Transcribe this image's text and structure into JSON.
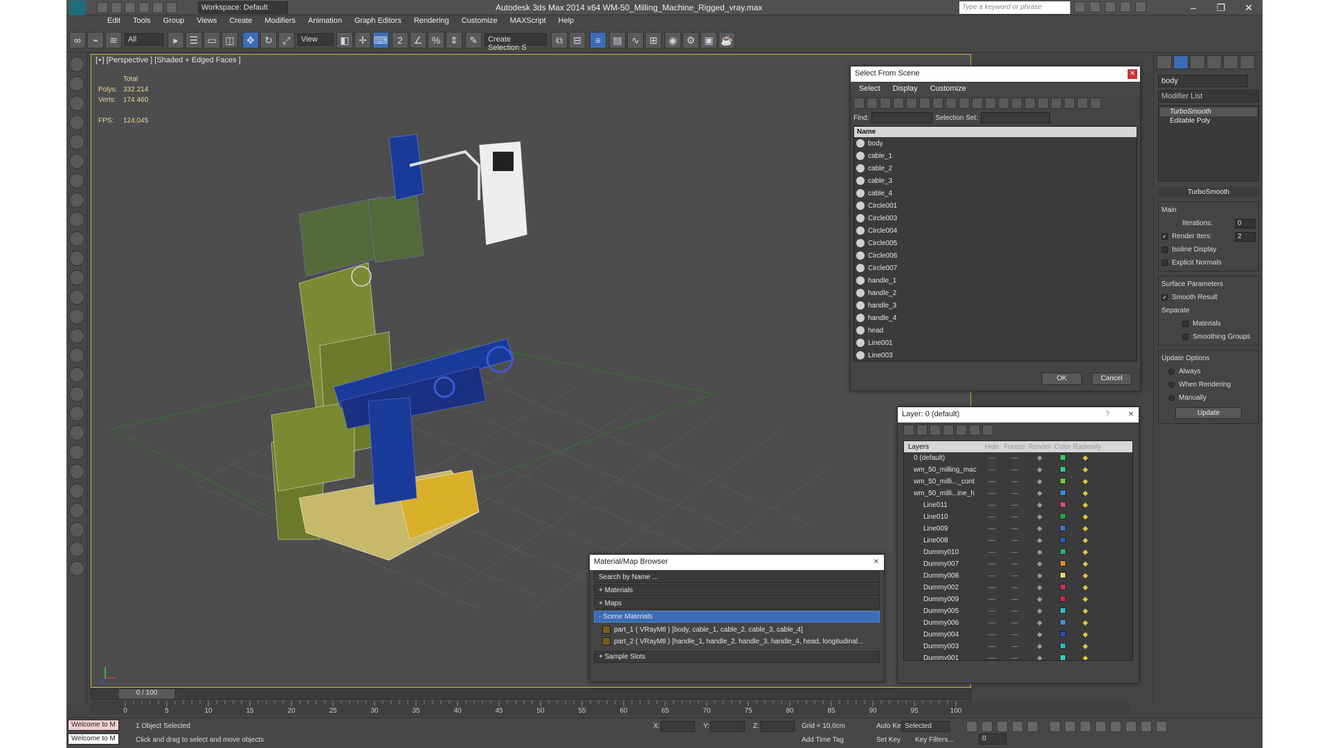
{
  "app": {
    "title": "Autodesk 3ds Max  2014 x64      WM-50_Milling_Machine_Rigged_vray.max",
    "workspace": "Workspace: Default",
    "search_placeholder": "Type a keyword or phrase"
  },
  "menu": [
    "Edit",
    "Tools",
    "Group",
    "Views",
    "Create",
    "Modifiers",
    "Animation",
    "Graph Editors",
    "Rendering",
    "Customize",
    "MAXScript",
    "Help"
  ],
  "toolbar": {
    "selection_filter": "All",
    "ref_coord": "View",
    "named_selection": "Create Selection S"
  },
  "viewport": {
    "label": "[+] [Perspective ] [Shaded + Edged Faces ]",
    "stats_total": "Total",
    "polys_label": "Polys:",
    "polys_value": "332 214",
    "verts_label": "Verts:",
    "verts_value": "174 460",
    "fps_label": "FPS:",
    "fps_value": "124,045"
  },
  "command_panel": {
    "object_name": "body",
    "modifier_list": "Modifier List",
    "stack": [
      "TurboSmooth",
      "Editable Poly"
    ],
    "rollout_title": "TurboSmooth",
    "main_label": "Main",
    "iterations_label": "Iterations:",
    "iterations_value": "0",
    "render_iters_label": "Render Iters:",
    "render_iters_value": "2",
    "isoline": "Isoline Display",
    "explicit_normals": "Explicit Normals",
    "surface_params": "Surface Parameters",
    "smooth_result": "Smooth Result",
    "separate": "Separate",
    "materials": "Materials",
    "smoothing_groups": "Smoothing Groups",
    "update_options": "Update Options",
    "always": "Always",
    "when_rendering": "When Rendering",
    "manually": "Manually",
    "update_button": "Update"
  },
  "select_from_scene": {
    "title": "Select From Scene",
    "menu": [
      "Select",
      "Display",
      "Customize"
    ],
    "find_label": "Find:",
    "selset_label": "Selection Set:",
    "name_header": "Name",
    "items": [
      "body",
      "cable_1",
      "cable_2",
      "cable_3",
      "cable_4",
      "Circle001",
      "Circle003",
      "Circle004",
      "Circle005",
      "Circle006",
      "Circle007",
      "handle_1",
      "handle_2",
      "handle_3",
      "handle_4",
      "head",
      "Line001",
      "Line003"
    ],
    "ok": "OK",
    "cancel": "Cancel"
  },
  "layer_dialog": {
    "title": "Layer: 0 (default)",
    "question": "?",
    "headers": [
      "Layers",
      "Hide",
      "Freeze",
      "Render",
      "Color",
      "Radiosity"
    ],
    "rows": [
      {
        "name": "0 (default)",
        "color": "#3cc85a"
      },
      {
        "name": "wm_50_milling_mac",
        "color": "#2ecc8a"
      },
      {
        "name": "wm_50_milli..._cont",
        "color": "#6ac83c"
      },
      {
        "name": "wm_50_milli...ine_h",
        "color": "#3a8ad8"
      },
      {
        "name": "Line011",
        "color": "#d84a7a"
      },
      {
        "name": "Line010",
        "color": "#2aa04a"
      },
      {
        "name": "Line009",
        "color": "#3a78c8"
      },
      {
        "name": "Line008",
        "color": "#2a5aa8"
      },
      {
        "name": "Dummy010",
        "color": "#2ab06a"
      },
      {
        "name": "Dummy007",
        "color": "#d8883a"
      },
      {
        "name": "Dummy008",
        "color": "#e6d86a"
      },
      {
        "name": "Dummy002",
        "color": "#c82a6a"
      },
      {
        "name": "Dummy009",
        "color": "#c82a4a"
      },
      {
        "name": "Dummy005",
        "color": "#3ab8c8"
      },
      {
        "name": "Dummy006",
        "color": "#4a8ad8"
      },
      {
        "name": "Dummy004",
        "color": "#2a4ab8"
      },
      {
        "name": "Dummy003",
        "color": "#2ab8b8"
      },
      {
        "name": "Dummy001",
        "color": "#3ac8c8"
      }
    ]
  },
  "material_browser": {
    "title": "Material/Map Browser",
    "search_placeholder": "Search by Name ...",
    "groups": [
      "+ Materials",
      "+ Maps",
      "- Scene Materials"
    ],
    "materials": [
      "part_1  ( VRayMtl )  [body, cable_1, cable_2, cable_3, cable_4]",
      "part_2  ( VRayMtl )  [handle_1, handle_2, handle_3, handle_4, head, longitudinal..."
    ],
    "sample_slots": "+ Sample Slots"
  },
  "timeline": {
    "frame": "0 / 100",
    "ticks": [
      "0",
      "5",
      "10",
      "15",
      "20",
      "25",
      "30",
      "35",
      "40",
      "45",
      "50",
      "55",
      "60",
      "65",
      "70",
      "75",
      "80",
      "85",
      "90",
      "95",
      "100"
    ]
  },
  "status": {
    "maxscript": "Welcome to M",
    "selected": "1 Object Selected",
    "prompt": "Click and drag to select and move objects",
    "x_label": "X:",
    "y_label": "Y:",
    "z_label": "Z:",
    "grid": "Grid = 10,0cm",
    "add_time_tag": "Add Time Tag",
    "auto_key": "Auto Key",
    "set_key": "Set Key",
    "selected_dropdown": "Selected",
    "key_filters": "Key Filters...",
    "frame_value": "0"
  },
  "colors": {
    "accent": "#3b6cb5",
    "viewport_border": "#c8b43c",
    "wire_blue": "#1a3a9a",
    "wire_green": "#8a9a3a",
    "wire_yellow": "#d8b02a"
  }
}
